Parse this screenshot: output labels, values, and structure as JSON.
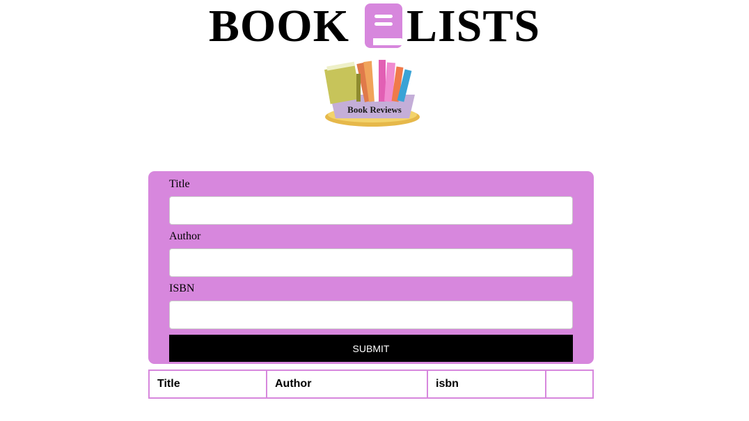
{
  "header": {
    "title_left": "BOOK",
    "title_right": "LISTS",
    "title_icon": "book-icon",
    "hero_image_caption": "Book Reviews"
  },
  "form": {
    "fields": [
      {
        "label": "Title",
        "value": "",
        "placeholder": ""
      },
      {
        "label": "Author",
        "value": "",
        "placeholder": ""
      },
      {
        "label": "ISBN",
        "value": "",
        "placeholder": ""
      }
    ],
    "submit_label": "Submit"
  },
  "table": {
    "columns": [
      "Title",
      "Author",
      "isbn",
      ""
    ]
  },
  "colors": {
    "accent": "#d787dd",
    "button": "#000000",
    "button_text": "#ffffff"
  }
}
